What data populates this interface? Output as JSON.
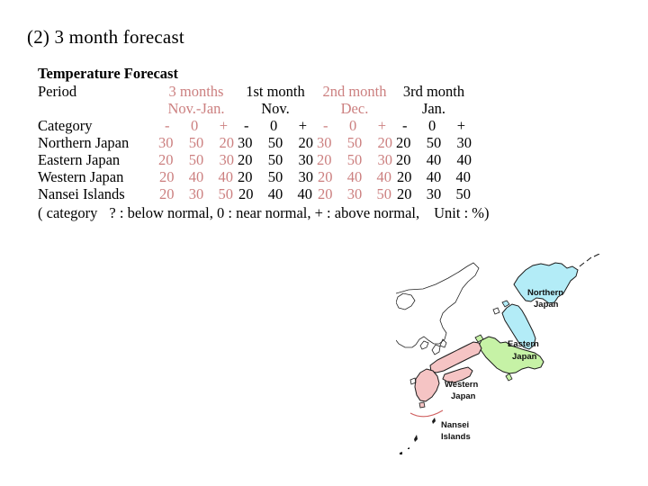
{
  "slide": {
    "title": "(2) 3 month forecast"
  },
  "table": {
    "caption": "Temperature Forecast",
    "period_label": "Period",
    "category_label": "Category",
    "columns": [
      {
        "period": "3 months",
        "months": "Nov.-Jan.",
        "highlight": true
      },
      {
        "period": "1st month",
        "months": "Nov.",
        "highlight": false
      },
      {
        "period": "2nd month",
        "months": "Dec.",
        "highlight": true
      },
      {
        "period": "3rd month",
        "months": "Jan.",
        "highlight": false
      }
    ],
    "category_symbols": [
      "-",
      "0",
      "+"
    ],
    "rows": [
      {
        "region": "Northern Japan",
        "values": [
          [
            "30",
            "50",
            "20"
          ],
          [
            "30",
            "50",
            "20"
          ],
          [
            "30",
            "50",
            "20"
          ],
          [
            "20",
            "50",
            "30"
          ]
        ]
      },
      {
        "region": "Eastern Japan",
        "values": [
          [
            "20",
            "50",
            "30"
          ],
          [
            "20",
            "50",
            "30"
          ],
          [
            "20",
            "50",
            "30"
          ],
          [
            "20",
            "40",
            "40"
          ]
        ]
      },
      {
        "region": "Western Japan",
        "values": [
          [
            "20",
            "40",
            "40"
          ],
          [
            "20",
            "50",
            "30"
          ],
          [
            "20",
            "40",
            "40"
          ],
          [
            "20",
            "40",
            "40"
          ]
        ]
      },
      {
        "region": "Nansei Islands",
        "values": [
          [
            "20",
            "30",
            "50"
          ],
          [
            "20",
            "40",
            "40"
          ],
          [
            "20",
            "30",
            "50"
          ],
          [
            "20",
            "30",
            "50"
          ]
        ]
      }
    ],
    "note": {
      "open": "( category",
      "below": "? : below normal,",
      "near": "0 : near normal,",
      "above": "+ : above normal,",
      "unit": "Unit : %)"
    },
    "highlight_color": "#cc8080"
  },
  "map": {
    "labels": {
      "northern": {
        "line1": "Northern",
        "line2": "Japan"
      },
      "eastern": {
        "line1": "Eastern",
        "line2": "Japan"
      },
      "western": {
        "line1": "Western",
        "line2": "Japan"
      },
      "nansei": {
        "line1": "Nansei",
        "line2": "Islands"
      }
    },
    "colors": {
      "northern": "#b3ecf7",
      "eastern": "#c6f2a6",
      "western": "#f5c4c4",
      "outline": "#1a1a1a"
    }
  }
}
